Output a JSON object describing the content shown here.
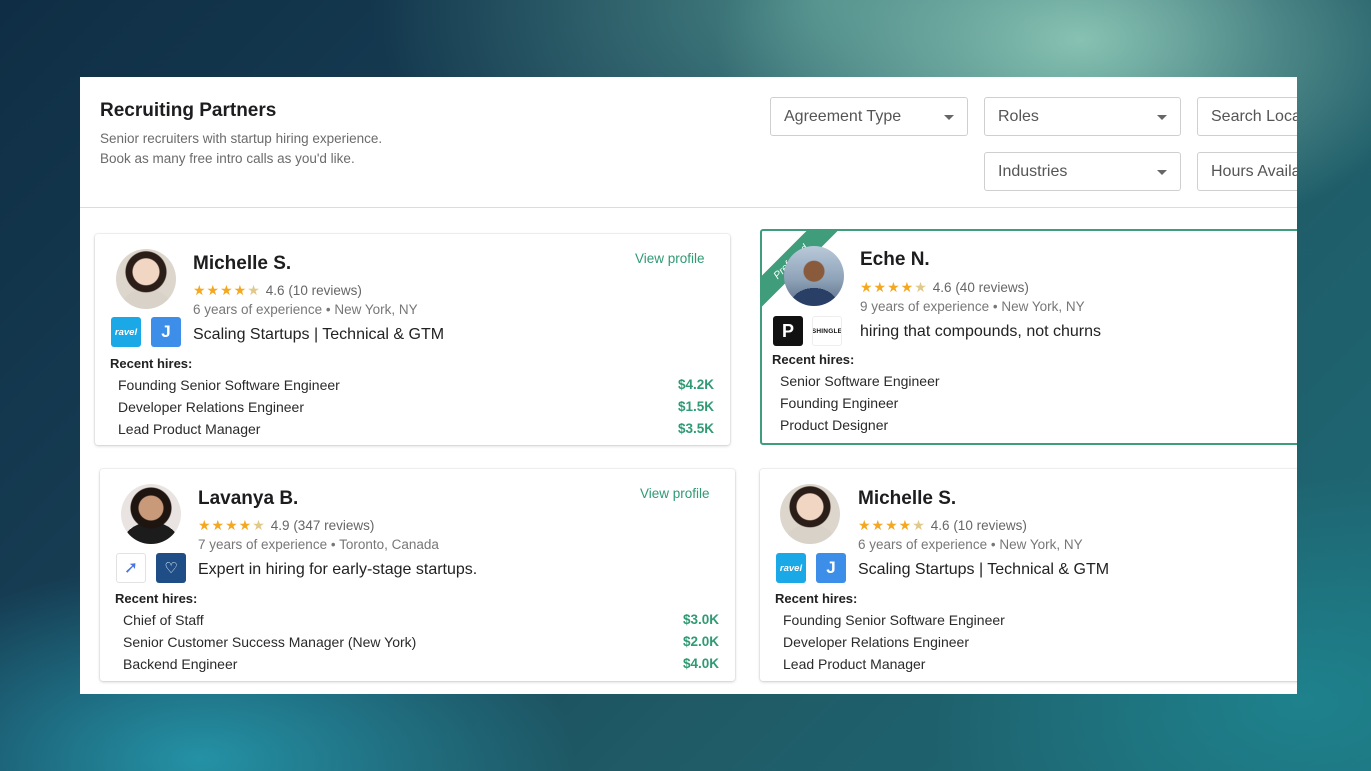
{
  "header": {
    "title": "Recruiting Partners",
    "subtitle_line1": "Senior recruiters with startup hiring experience.",
    "subtitle_line2": "Book as many free intro calls as you'd like."
  },
  "filters": {
    "agreement_type": "Agreement Type",
    "roles": "Roles",
    "search_location": "Search Loca",
    "industries": "Industries",
    "hours_available": "Hours Availa"
  },
  "recruiters": [
    {
      "name": "Michelle S.",
      "stars": "★★★★★",
      "rating": "4.6",
      "reviews": "(10 reviews)",
      "years": "6 years of experience",
      "location": "New York, NY",
      "tagline": "Scaling Startups | Technical & GTM",
      "logos": [
        "ravel",
        "J"
      ],
      "view_profile": "View profile",
      "hires_label": "Recent hires:",
      "hires": [
        {
          "role": "Founding Senior Software Engineer",
          "fee": "$4.2K"
        },
        {
          "role": "Developer Relations Engineer",
          "fee": "$1.5K"
        },
        {
          "role": "Lead Product Manager",
          "fee": "$3.5K"
        }
      ]
    },
    {
      "name": "Eche N.",
      "badge": "Preferred",
      "stars": "★★★★★",
      "rating": "4.6",
      "reviews": "(40 reviews)",
      "years": "9 years of experience",
      "location": "New York, NY",
      "tagline": "hiring that compounds, not churns",
      "logos": [
        "SHINGLE"
      ],
      "hires_label": "Recent hires:",
      "hires": [
        {
          "role": "Senior Software Engineer"
        },
        {
          "role": "Founding Engineer"
        },
        {
          "role": "Product Designer"
        }
      ]
    },
    {
      "name": "Lavanya B.",
      "stars": "★★★★★",
      "rating": "4.9",
      "reviews": "(347 reviews)",
      "years": "7 years of experience",
      "location": "Toronto, Canada",
      "tagline": "Expert in hiring for early-stage startups.",
      "view_profile": "View profile",
      "hires_label": "Recent hires:",
      "hires": [
        {
          "role": "Chief of Staff",
          "fee": "$3.0K"
        },
        {
          "role": "Senior Customer Success Manager (New York)",
          "fee": "$2.0K"
        },
        {
          "role": "Backend Engineer",
          "fee": "$4.0K"
        }
      ]
    },
    {
      "name": "Michelle S.",
      "stars": "★★★★★",
      "rating": "4.6",
      "reviews": "(10 reviews)",
      "years": "6 years of experience",
      "location": "New York, NY",
      "tagline": "Scaling Startups | Technical & GTM",
      "logos": [
        "ravel",
        "J"
      ],
      "hires_label": "Recent hires:",
      "hires": [
        {
          "role": "Founding Senior Software Engineer"
        },
        {
          "role": "Developer Relations Engineer"
        },
        {
          "role": "Lead Product Manager"
        }
      ]
    }
  ],
  "icons": {
    "caret": "chevron-down-icon",
    "star": "star-icon",
    "separator": "•"
  },
  "colors": {
    "accent_green": "#2f9a74",
    "star_yellow": "#f4a820",
    "preferred_border": "#3f9d7c"
  }
}
